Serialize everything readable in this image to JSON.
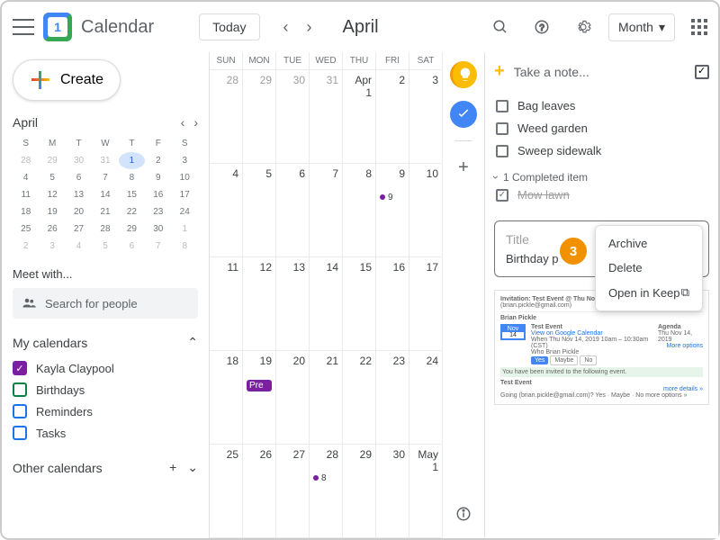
{
  "header": {
    "app_title": "Calendar",
    "logo_day": "1",
    "today_label": "Today",
    "month_label": "April",
    "view_label": "Month"
  },
  "sidebar": {
    "create_label": "Create",
    "mini_month": "April",
    "mini_days": [
      "S",
      "M",
      "T",
      "W",
      "T",
      "F",
      "S"
    ],
    "mini_weeks": [
      [
        {
          "d": "28",
          "dim": true
        },
        {
          "d": "29",
          "dim": true
        },
        {
          "d": "30",
          "dim": true
        },
        {
          "d": "31",
          "dim": true
        },
        {
          "d": "1",
          "today": true
        },
        {
          "d": "2"
        },
        {
          "d": "3"
        }
      ],
      [
        {
          "d": "4"
        },
        {
          "d": "5"
        },
        {
          "d": "6"
        },
        {
          "d": "7"
        },
        {
          "d": "8"
        },
        {
          "d": "9"
        },
        {
          "d": "10"
        }
      ],
      [
        {
          "d": "11"
        },
        {
          "d": "12"
        },
        {
          "d": "13"
        },
        {
          "d": "14"
        },
        {
          "d": "15"
        },
        {
          "d": "16"
        },
        {
          "d": "17"
        }
      ],
      [
        {
          "d": "18"
        },
        {
          "d": "19"
        },
        {
          "d": "20"
        },
        {
          "d": "21"
        },
        {
          "d": "22"
        },
        {
          "d": "23"
        },
        {
          "d": "24"
        }
      ],
      [
        {
          "d": "25"
        },
        {
          "d": "26"
        },
        {
          "d": "27"
        },
        {
          "d": "28"
        },
        {
          "d": "29"
        },
        {
          "d": "30"
        },
        {
          "d": "1",
          "dim": true
        }
      ],
      [
        {
          "d": "2",
          "dim": true
        },
        {
          "d": "3",
          "dim": true
        },
        {
          "d": "4",
          "dim": true
        },
        {
          "d": "5",
          "dim": true
        },
        {
          "d": "6",
          "dim": true
        },
        {
          "d": "7",
          "dim": true
        },
        {
          "d": "8",
          "dim": true
        }
      ]
    ],
    "meet_label": "Meet with...",
    "search_placeholder": "Search for people",
    "my_calendars_label": "My calendars",
    "other_calendars_label": "Other calendars",
    "calendars": [
      {
        "label": "Kayla Claypool",
        "color": "#7b1fa2",
        "checked": true
      },
      {
        "label": "Birthdays",
        "color": "#0b8043",
        "checked": false
      },
      {
        "label": "Reminders",
        "color": "#1a73e8",
        "checked": false
      },
      {
        "label": "Tasks",
        "color": "#1a73e8",
        "checked": false
      }
    ]
  },
  "grid": {
    "day_heads": [
      "SUN",
      "MON",
      "TUE",
      "WED",
      "THU",
      "FRI",
      "SAT"
    ],
    "weeks": [
      [
        {
          "d": "28",
          "dim": true
        },
        {
          "d": "29",
          "dim": true
        },
        {
          "d": "30",
          "dim": true
        },
        {
          "d": "31",
          "dim": true
        },
        {
          "d": "Apr 1"
        },
        {
          "d": "2"
        },
        {
          "d": "3"
        }
      ],
      [
        {
          "d": "4"
        },
        {
          "d": "5"
        },
        {
          "d": "6"
        },
        {
          "d": "7"
        },
        {
          "d": "8"
        },
        {
          "d": "9",
          "event_dot": "9"
        },
        {
          "d": "10"
        }
      ],
      [
        {
          "d": "11"
        },
        {
          "d": "12"
        },
        {
          "d": "13"
        },
        {
          "d": "14"
        },
        {
          "d": "15"
        },
        {
          "d": "16"
        },
        {
          "d": "17"
        }
      ],
      [
        {
          "d": "18"
        },
        {
          "d": "19",
          "chip": "Pre"
        },
        {
          "d": "20"
        },
        {
          "d": "21"
        },
        {
          "d": "22"
        },
        {
          "d": "23"
        },
        {
          "d": "24"
        }
      ],
      [
        {
          "d": "25"
        },
        {
          "d": "26"
        },
        {
          "d": "27"
        },
        {
          "d": "28",
          "event_dot": "8"
        },
        {
          "d": "29"
        },
        {
          "d": "30"
        },
        {
          "d": "May 1"
        }
      ]
    ]
  },
  "keep": {
    "take_note_label": "Take a note...",
    "todos": [
      {
        "label": "Bag leaves",
        "done": false
      },
      {
        "label": "Weed garden",
        "done": false
      },
      {
        "label": "Sweep sidewalk",
        "done": false
      }
    ],
    "completed_header": "1 Completed item",
    "completed_item": "Mow lawn",
    "note": {
      "title_placeholder": "Title",
      "body": "Birthday p"
    },
    "context_menu": [
      {
        "label": "Archive"
      },
      {
        "label": "Delete"
      },
      {
        "label": "Open in Keep",
        "external": true
      }
    ],
    "step_badge": "3",
    "email_preview": {
      "subject": "Invitation: Test Event @ Thu Nov 14, 2019 10am - 10:30am (CST)",
      "recipient": "(brian.pickle@gmail.com)",
      "sender": "Brian Pickle",
      "cal_month": "Nov",
      "cal_day": "14",
      "event_title": "Test Event",
      "view_link": "View on Google Calendar",
      "when": "When   Thu Nov 14, 2019 10am – 10:30am (CST)",
      "who": "Who    Brian Pickle",
      "agenda_label": "Agenda",
      "agenda_date": "Thu Nov 14, 2019",
      "btn_yes": "Yes",
      "btn_maybe": "Maybe",
      "btn_no": "No",
      "more_options": "More options",
      "green_bar": "You have been invited to the following event.",
      "event_title2": "Test Event",
      "going": "Going (brian.pickle@gmail.com)?   Yes · Maybe · No    more options »",
      "more_details": "more details »"
    }
  }
}
